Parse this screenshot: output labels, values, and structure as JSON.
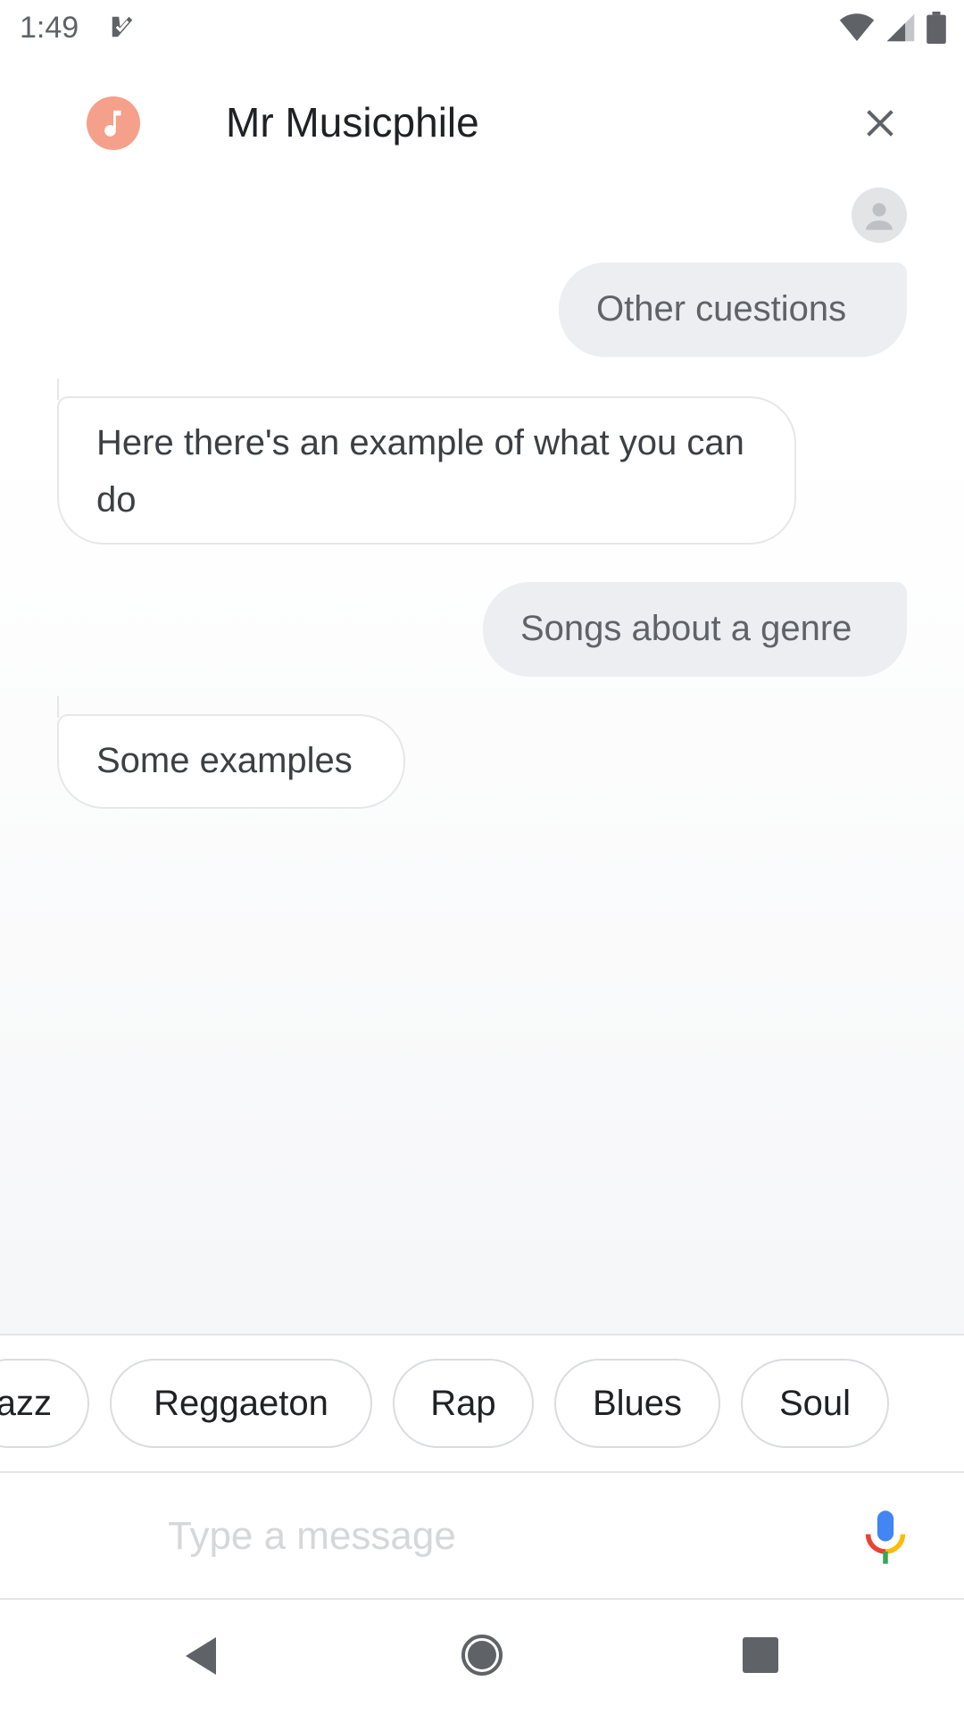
{
  "status_bar": {
    "time": "1:49",
    "icons": [
      "notification-check-icon",
      "wifi-icon",
      "cellular-signal-icon",
      "battery-icon"
    ]
  },
  "header": {
    "agent_name": "Mr Musicphile",
    "agent_icon": "music-note-icon",
    "close_icon": "close-icon"
  },
  "conversation": {
    "messages": [
      {
        "from": "user",
        "text": "Other cuestions"
      },
      {
        "from": "bot",
        "text": "Here there's an example of what you can do"
      },
      {
        "from": "user",
        "text": "Songs about a genre"
      },
      {
        "from": "bot",
        "text": "Some examples"
      }
    ]
  },
  "suggestions": {
    "chips": [
      "azz",
      "Reggaeton",
      "Rap",
      "Blues",
      "Soul"
    ]
  },
  "composer": {
    "placeholder": "Type a message",
    "value": "",
    "mic_icon": "microphone-icon"
  },
  "nav_bar": {
    "icons": [
      "back-icon",
      "home-icon",
      "recents-icon"
    ]
  },
  "colors": {
    "agent_avatar": "#f4a08b",
    "user_bubble": "#eceef1",
    "bot_bubble_border": "#e6e7e9",
    "mic_blue": "#4285f4",
    "mic_red": "#ea4335",
    "mic_yellow": "#fbbc05",
    "mic_green": "#34a853"
  }
}
